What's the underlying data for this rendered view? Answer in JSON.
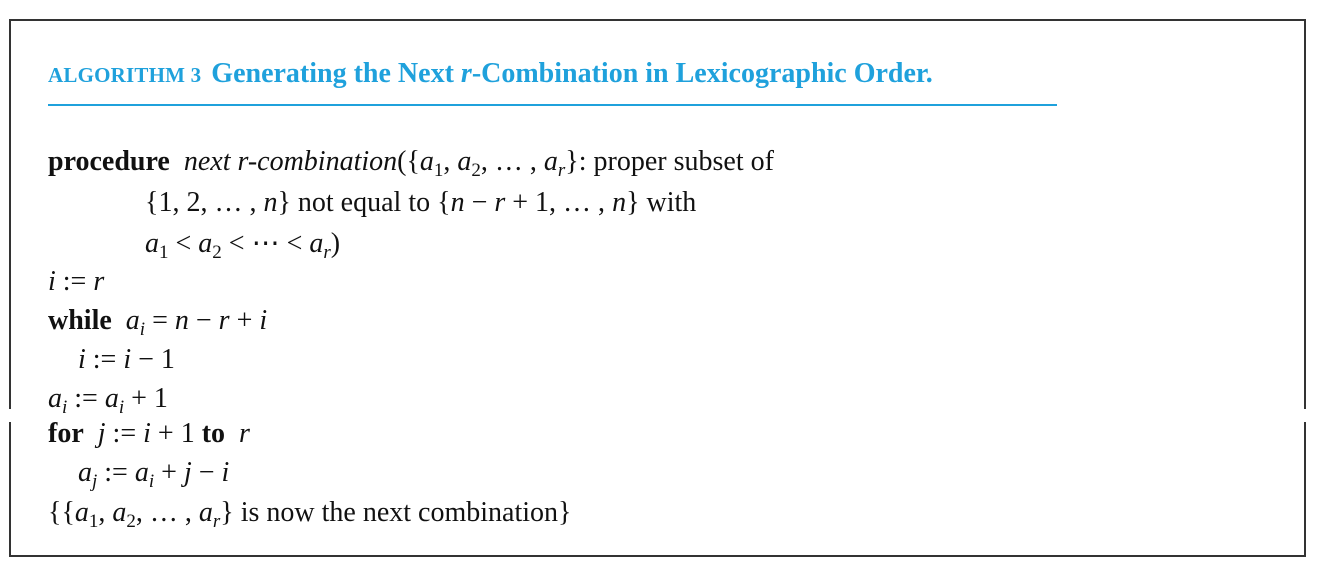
{
  "algorithm": {
    "label": "ALGORITHM 3",
    "title_pre": "Generating the Next ",
    "title_r": "r",
    "title_post": "-Combination in Lexicographic Order."
  },
  "code": {
    "kw_procedure": "procedure",
    "kw_while": "while",
    "kw_for": "for",
    "kw_to": "to",
    "proc_name": "next r-combination",
    "proc_tail": ": proper subset of",
    "line2_text": " not equal to ",
    "line2_with": " with",
    "comment_text": " is now the next combination"
  }
}
